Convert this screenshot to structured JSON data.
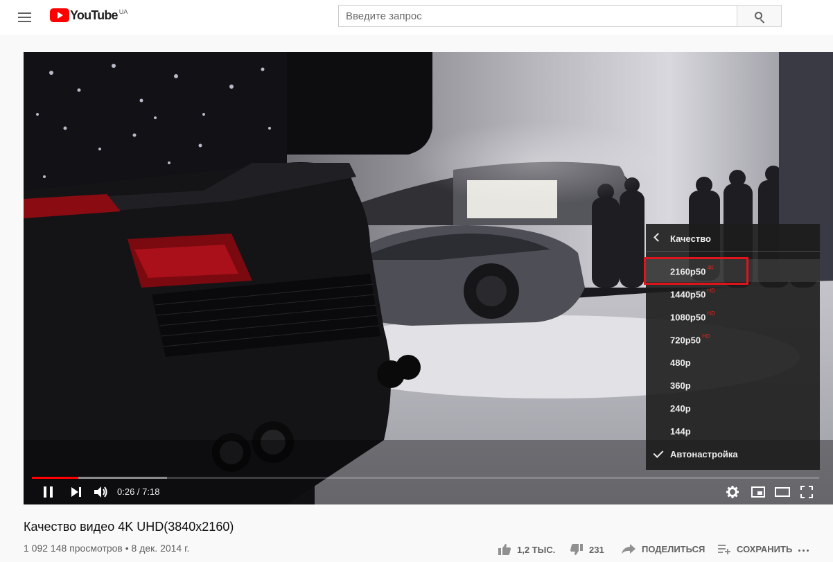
{
  "header": {
    "logo_text": "YouTube",
    "country_code": "UA",
    "search_placeholder": "Введите запрос"
  },
  "player": {
    "current_time": "0:26",
    "duration": "7:18",
    "time_display": "0:26 / 7:18",
    "progress_fraction": 0.059,
    "buffered_fraction": 0.172,
    "quality_menu": {
      "title": "Качество",
      "options": [
        {
          "label": "2160p50",
          "badge": "4K",
          "highlighted": true
        },
        {
          "label": "1440p50",
          "badge": "HD"
        },
        {
          "label": "1080p50",
          "badge": "HD"
        },
        {
          "label": "720p50",
          "badge": "HD"
        },
        {
          "label": "480p",
          "badge": ""
        },
        {
          "label": "360p",
          "badge": ""
        },
        {
          "label": "240p",
          "badge": ""
        },
        {
          "label": "144p",
          "badge": ""
        },
        {
          "label": "Автонастройка",
          "badge": "",
          "checked": true
        }
      ],
      "highlight_color": "#e0141b"
    }
  },
  "video_info": {
    "title": "Качество видео 4K UHD(3840x2160)",
    "views": "1 092 148 просмотров",
    "date": "8 дек. 2014 г.",
    "meta_line": "1 092 148 просмотров • 8 дек. 2014 г.",
    "likes": "1,2 ТЫС.",
    "dislikes": "231",
    "share_label": "ПОДЕЛИТЬСЯ",
    "save_label": "СОХРАНИТЬ"
  },
  "colors": {
    "brand_red": "#ff0000",
    "progress_red": "#ff0000",
    "badge_red": "#e62117"
  }
}
